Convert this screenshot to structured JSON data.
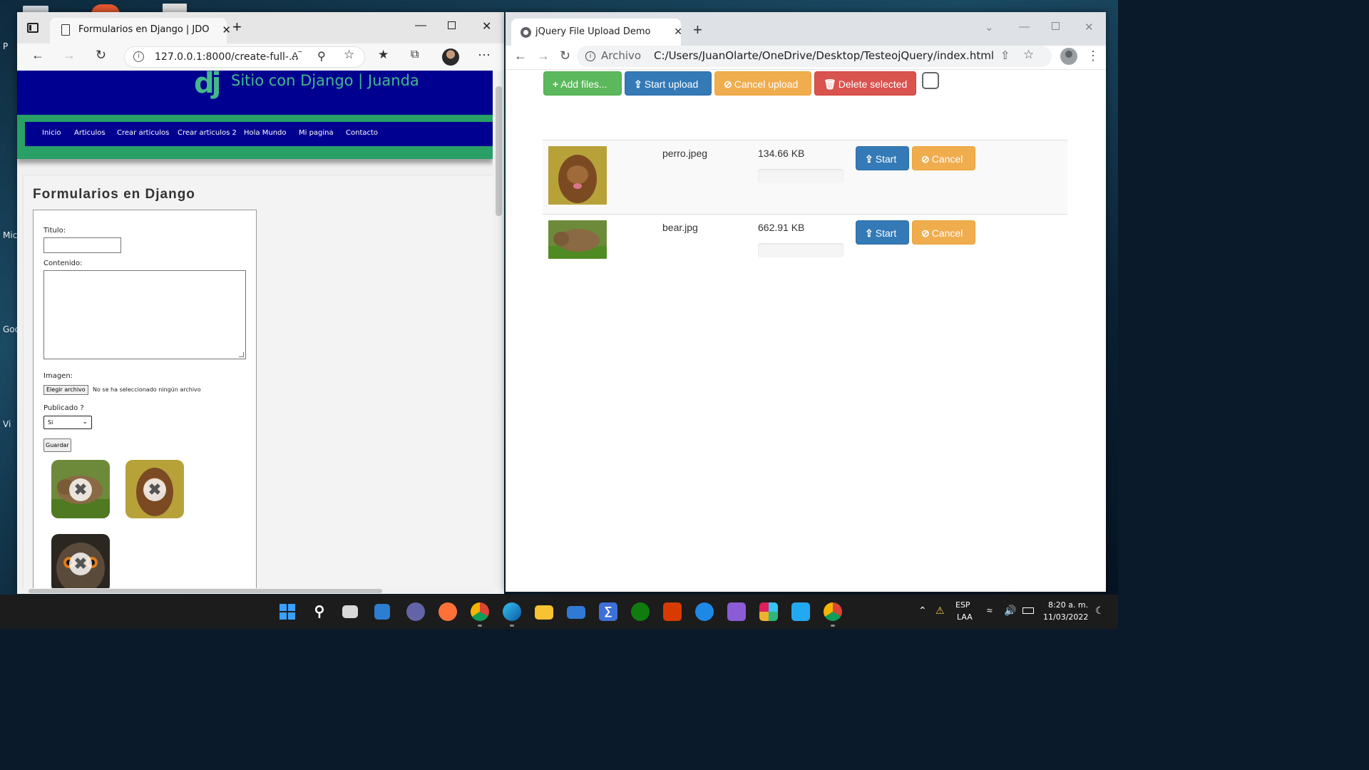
{
  "desktop": {
    "labels": [
      "P",
      "Mic",
      "Goo",
      "Vi"
    ]
  },
  "edge": {
    "tab_title": "Formularios en Django | JDO",
    "tab_close": "✕",
    "new_tab": "+",
    "url": "127.0.0.1:8000/create-full-...",
    "site": {
      "logo": "dj",
      "title": "Sitio con Django | Juanda",
      "nav": [
        "Inicio",
        "Articulos",
        "Crear articulos",
        "Crear articulos 2",
        "Hola Mundo",
        "Mi pagina",
        "Contacto"
      ]
    },
    "page_title": "Formularios en Django",
    "form": {
      "titulo_label": "Titulo:",
      "contenido_label": "Contenido:",
      "imagen_label": "Imagen:",
      "file_button": "Elegir archivo",
      "file_text": "No se ha seleccionado ningún archivo",
      "publicado_label": "Publicado ?",
      "publicado_value": "Si",
      "submit": "Guardar"
    },
    "thumbnails": [
      "bear",
      "puppy",
      "owl"
    ]
  },
  "chrome": {
    "tab_title": "jQuery File Upload Demo",
    "tab_close": "✕",
    "new_tab": "+",
    "scheme": "Archivo",
    "url": "C:/Users/JuanOlarte/OneDrive/Desktop/TesteojQuery/index.html",
    "toolbar": {
      "add_files": "Add files...",
      "start_upload": "Start upload",
      "cancel_upload": "Cancel upload",
      "delete_selected": "Delete selected"
    },
    "files": [
      {
        "name": "perro.jpeg",
        "size": "134.66 KB",
        "progress": 0,
        "start": "Start",
        "cancel": "Cancel"
      },
      {
        "name": "bear.jpg",
        "size": "662.91 KB",
        "progress": 0,
        "start": "Start",
        "cancel": "Cancel"
      }
    ]
  },
  "taskbar": {
    "lang": "ESP",
    "layout": "LAA",
    "time": "8:20 a. m.",
    "date": "11/03/2022"
  },
  "colors": {
    "site_header": "#000090",
    "site_accent": "#28a066",
    "btn_success": "#5cb85c",
    "btn_primary": "#337ab7",
    "btn_warning": "#f0ad4e",
    "btn_danger": "#d9534f"
  }
}
